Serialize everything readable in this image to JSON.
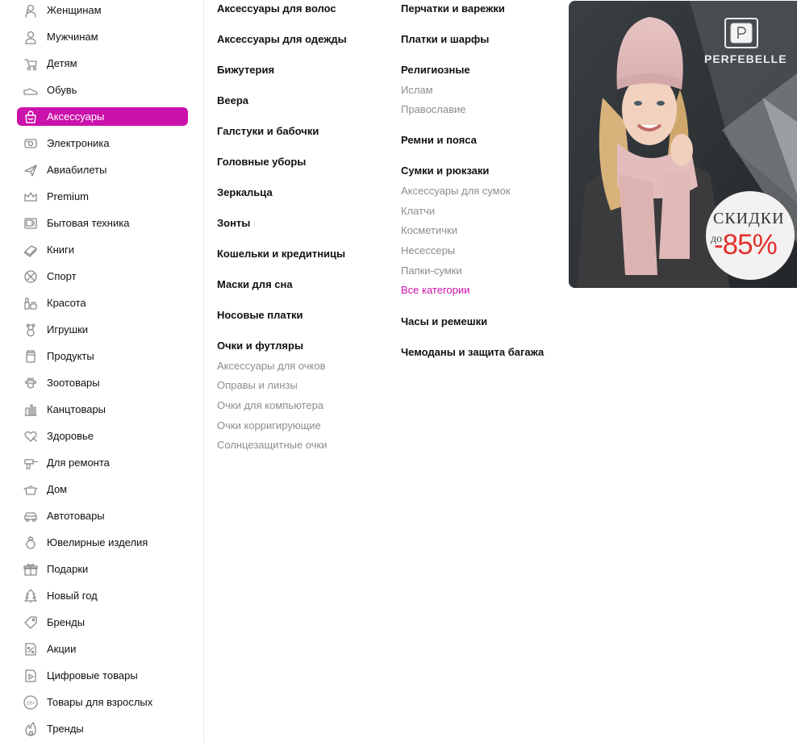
{
  "sidebar": {
    "items": [
      {
        "label": "Женщинам",
        "icon": "woman-icon"
      },
      {
        "label": "Мужчинам",
        "icon": "man-icon"
      },
      {
        "label": "Детям",
        "icon": "stroller-icon"
      },
      {
        "label": "Обувь",
        "icon": "shoe-icon"
      },
      {
        "label": "Аксессуары",
        "icon": "bag-icon",
        "active": true
      },
      {
        "label": "Электроника",
        "icon": "electronics-icon"
      },
      {
        "label": "Авиабилеты",
        "icon": "plane-icon"
      },
      {
        "label": "Premium",
        "icon": "crown-icon"
      },
      {
        "label": "Бытовая техника",
        "icon": "appliance-icon"
      },
      {
        "label": "Книги",
        "icon": "book-icon"
      },
      {
        "label": "Спорт",
        "icon": "ball-icon"
      },
      {
        "label": "Красота",
        "icon": "cosmetics-icon"
      },
      {
        "label": "Игрушки",
        "icon": "teddy-bear-icon"
      },
      {
        "label": "Продукты",
        "icon": "food-jar-icon"
      },
      {
        "label": "Зоотовары",
        "icon": "paw-icon"
      },
      {
        "label": "Канцтовары",
        "icon": "stationery-icon"
      },
      {
        "label": "Здоровье",
        "icon": "heart-health-icon"
      },
      {
        "label": "Для ремонта",
        "icon": "drill-icon"
      },
      {
        "label": "Дом",
        "icon": "pot-icon"
      },
      {
        "label": "Автотовары",
        "icon": "car-icon"
      },
      {
        "label": "Ювелирные изделия",
        "icon": "ring-icon"
      },
      {
        "label": "Подарки",
        "icon": "gift-icon"
      },
      {
        "label": "Новый год",
        "icon": "christmas-tree-icon"
      },
      {
        "label": "Бренды",
        "icon": "tag-icon"
      },
      {
        "label": "Акции",
        "icon": "discount-icon"
      },
      {
        "label": "Цифровые товары",
        "icon": "digital-file-icon"
      },
      {
        "label": "Товары для взрослых",
        "icon": "age-18-icon"
      },
      {
        "label": "Тренды",
        "icon": "flame-icon"
      }
    ]
  },
  "menu": {
    "col1": [
      {
        "label": "Аксессуары для волос",
        "sub": []
      },
      {
        "label": "Аксессуары для одежды",
        "sub": []
      },
      {
        "label": "Бижутерия",
        "sub": []
      },
      {
        "label": "Веера",
        "sub": []
      },
      {
        "label": "Галстуки и бабочки",
        "sub": []
      },
      {
        "label": "Головные уборы",
        "sub": []
      },
      {
        "label": "Зеркальца",
        "sub": []
      },
      {
        "label": "Зонты",
        "sub": []
      },
      {
        "label": "Кошельки и кредитницы",
        "sub": []
      },
      {
        "label": "Маски для сна",
        "sub": []
      },
      {
        "label": "Носовые платки",
        "sub": []
      },
      {
        "label": "Очки и футляры",
        "sub": [
          "Аксессуары для очков",
          "Оправы и линзы",
          "Очки для компьютера",
          "Очки корригирующие",
          "Солнцезащитные очки"
        ]
      }
    ],
    "col2": [
      {
        "label": "Перчатки и варежки",
        "sub": []
      },
      {
        "label": "Платки и шарфы",
        "sub": []
      },
      {
        "label": "Религиозные",
        "sub": [
          "Ислам",
          "Православие"
        ]
      },
      {
        "label": "Ремни и пояса",
        "sub": []
      },
      {
        "label": "Сумки и рюкзаки",
        "sub": [
          "Аксессуары для сумок",
          "Клатчи",
          "Косметички",
          "Несессеры",
          "Папки-сумки"
        ],
        "all_link": "Все категории"
      },
      {
        "label": "Часы и ремешки",
        "sub": []
      },
      {
        "label": "Чемоданы и защита багажа",
        "sub": []
      }
    ]
  },
  "banner": {
    "brand": "PERFEBELLE",
    "discount_title": "СКИДКИ",
    "discount_prefix": "до",
    "discount_value": "-85%"
  },
  "colors": {
    "accent": "#cb11ab",
    "discount_red": "#e3312c"
  }
}
